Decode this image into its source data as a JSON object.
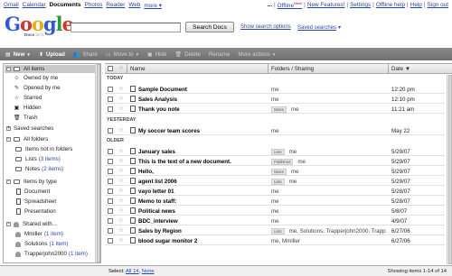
{
  "top_nav": [
    {
      "label": "Gmail",
      "active": false
    },
    {
      "label": "Calendar",
      "active": false
    },
    {
      "label": "Documents",
      "active": true
    },
    {
      "label": "Photos",
      "active": false
    },
    {
      "label": "Reader",
      "active": false
    },
    {
      "label": "Web",
      "active": false
    },
    {
      "label": "more ▾",
      "active": false
    }
  ],
  "top_links": {
    "user": "...",
    "offline": "Offline",
    "offline_badge": "New!",
    "new_features": "New Features!",
    "settings": "Settings",
    "offline_help": "Offline help",
    "help": "Help",
    "sign_out": "Sign out"
  },
  "logo": {
    "letters": [
      "G",
      "o",
      "o",
      "g",
      "l",
      "e"
    ],
    "product": "Docs",
    "beta": "BETA"
  },
  "search": {
    "value": "",
    "button_label": "Search Docs",
    "show_options": "Show search options",
    "saved_searches": "Saved searches"
  },
  "toolbar": {
    "new": "New",
    "upload": "Upload",
    "share": "Share",
    "move_to": "Move to",
    "hide": "Hide",
    "delete": "Delete",
    "rename": "Rename",
    "more_actions": "More actions"
  },
  "sidebar": {
    "all_items": "All items",
    "owned_by_me": "Owned by me",
    "opened_by_me": "Opened by me",
    "starred": "Starred",
    "hidden": "Hidden",
    "trash": "Trash",
    "saved_searches": "Saved searches",
    "all_folders": "All folders",
    "items_not_in_folders": "Items not in folders",
    "lists": "Lists",
    "lists_count": "(3 items)",
    "notes": "Notes",
    "notes_count": "(2 items)",
    "items_by_type": "Items by type",
    "document": "Document",
    "spreadsheet": "Spreadsheet",
    "presentation": "Presentation",
    "shared_with": "Shared with...",
    "shared_1": "Mmiller",
    "shared_1_count": "(1 item)",
    "shared_2": "Solutions",
    "shared_2_count": "(1 item)",
    "shared_3": "Trapperjohn2000",
    "shared_3_count": "(1 item)"
  },
  "columns": {
    "name": "Name",
    "folders": "Folders / Sharing",
    "date": "Date"
  },
  "sections": {
    "today": "TODAY",
    "yesterday": "YESTERDAY",
    "older": "OLDER"
  },
  "rows": [
    {
      "name": "Sample Document",
      "tag": "",
      "shared": "me",
      "date": "12:20 pm"
    },
    {
      "name": "Sales Analysis",
      "tag": "",
      "shared": "me",
      "date": "12:10 pm"
    },
    {
      "name": "Thank you note",
      "tag": "Notes",
      "shared": "me",
      "date": "11:21 am"
    },
    {
      "name": "My soccer team scores",
      "tag": "",
      "shared": "me",
      "date": "May 22"
    },
    {
      "name": "January sales",
      "tag": "Lists",
      "shared": "me",
      "date": "5/29/07"
    },
    {
      "name": "This is the text of a new document.",
      "tag": "Published",
      "shared": "me",
      "date": "5/29/07"
    },
    {
      "name": "Hello,",
      "tag": "Notes",
      "shared": "me",
      "date": "5/29/07"
    },
    {
      "name": "agent list 2006",
      "tag": "Lists",
      "shared": "me",
      "date": "5/29/07"
    },
    {
      "name": "vayo letter 01",
      "tag": "",
      "shared": "me",
      "date": "5/28/07"
    },
    {
      "name": "Memo to staff:",
      "tag": "",
      "shared": "me",
      "date": "5/28/07"
    },
    {
      "name": "Political news",
      "tag": "",
      "shared": "me",
      "date": "5/8/07"
    },
    {
      "name": "BDC_interview",
      "tag": "",
      "shared": "me",
      "date": "4/9/07"
    },
    {
      "name": "Sales by Region",
      "tag": "Lists",
      "shared": "me, Solutions, Trapperjohn2000, Trapp",
      "date": "6/27/06"
    },
    {
      "name": "blood sugar monitor 2",
      "tag": "",
      "shared": "me, Mmiller",
      "date": "6/27/06"
    }
  ],
  "status": {
    "select_label": "Select:",
    "select_all": "All 14",
    "select_none": "None",
    "count": "Showing items 1-14 of 14"
  }
}
